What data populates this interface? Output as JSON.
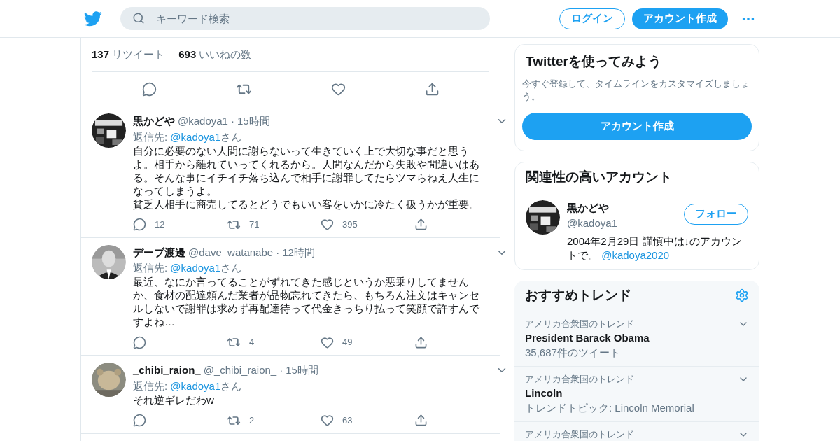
{
  "header": {
    "search": {
      "placeholder": "キーワード検索"
    },
    "login": "ログイン",
    "signup": "アカウント作成"
  },
  "stats": [
    {
      "count": "137",
      "label": "リツイート"
    },
    {
      "count": "693",
      "label": "いいねの数"
    }
  ],
  "tweets": [
    {
      "name": "黒かどや",
      "handle": "@kadoya1",
      "time": "15時間",
      "reply_prefix": "返信先: ",
      "reply_handle": "@kadoya1",
      "reply_suffix": "さん",
      "separator": "·",
      "text": [
        "自分に必要のない人間に謝らないって生きていく上で大切な事だと思うよ。相手から離れていってくれるから。人間なんだから失敗や間違いはある。そんな事にイチイチ落ち込んで相手に謝罪してたらツマらねえ人生になってしまうよ。",
        "貧乏人相手に商売してるとどうでもいい客をいかに冷たく扱うかが重要。"
      ],
      "replies": "12",
      "retweets": "71",
      "likes": "395"
    },
    {
      "name": "デーブ渡邊",
      "handle": "@dave_watanabe",
      "time": "12時間",
      "reply_prefix": "返信先: ",
      "reply_handle": "@kadoya1",
      "reply_suffix": "さん",
      "separator": "·",
      "text": [
        "最近、なにか言ってることがずれてきた感じというか悪乗りしてませんか、食材の配達頼んだ業者が品物忘れてきたら、もちろん注文はキャンセルしないで謝罪は求めず再配達待って代金きっちり払って笑顔で許すんですよね…"
      ],
      "retweets": "4",
      "likes": "49"
    },
    {
      "name": "_chibi_raion_",
      "handle": "@_chibi_raion_",
      "time": "15時間",
      "reply_prefix": "返信先: ",
      "reply_handle": "@kadoya1",
      "reply_suffix": "さん",
      "separator": "·",
      "text": [
        "それ逆ギレだわw"
      ],
      "retweets": "2",
      "likes": "63"
    }
  ],
  "signup_card": {
    "title": "Twitterを使ってみよう",
    "text": "今すぐ登録して、タイムラインをカスタマイズしましょう。",
    "button": "アカウント作成"
  },
  "related": {
    "title": "関連性の高いアカウント",
    "name": "黒かどや",
    "handle": "@kadoya1",
    "follow": "フォロー",
    "bio": "2004年2月29日 謹慎中は↓のアカウントで。 ",
    "bio_link": "@kadoya2020"
  },
  "trends": {
    "title": "おすすめトレンド",
    "items": [
      {
        "context": "アメリカ合衆国のトレンド",
        "name": "President Barack Obama",
        "meta": "35,687件のツイート"
      },
      {
        "context": "アメリカ合衆国のトレンド",
        "name": "Lincoln",
        "meta": "トレンドトピック: Lincoln Memorial"
      },
      {
        "context": "アメリカ合衆国のトレンド"
      }
    ]
  }
}
